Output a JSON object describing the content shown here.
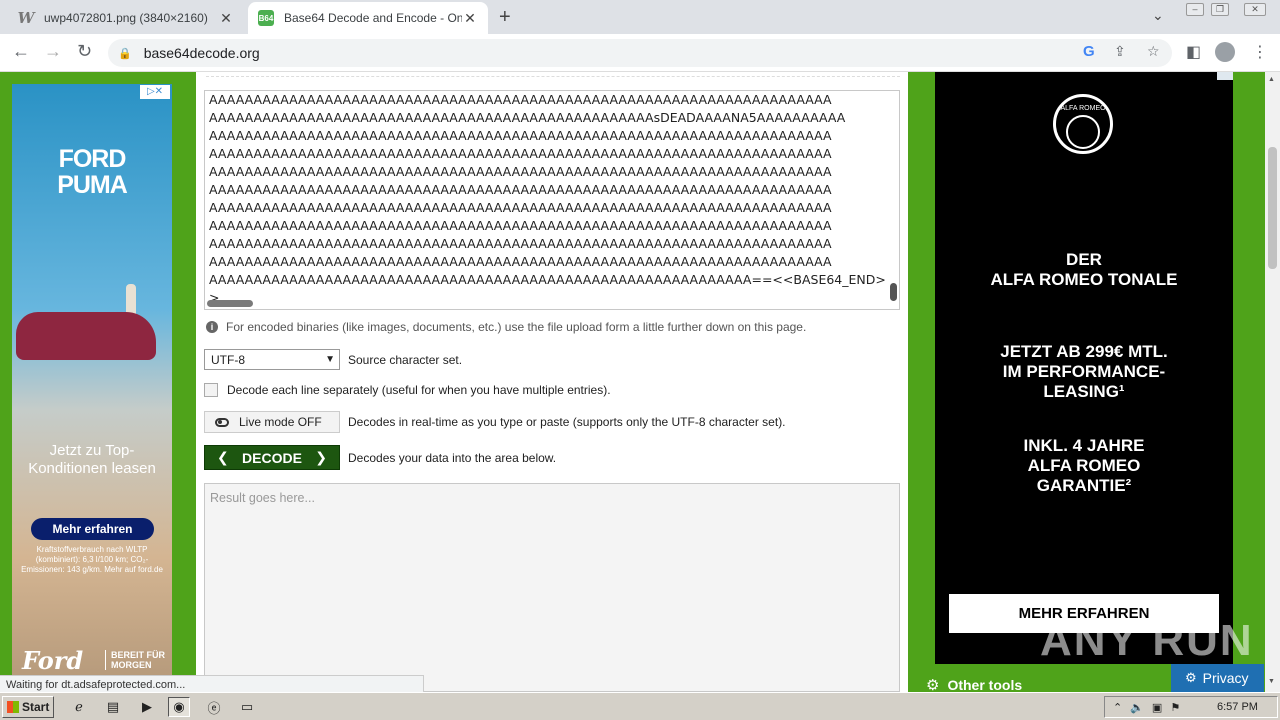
{
  "browser": {
    "tabs": [
      {
        "title": "uwp4072801.png (3840×2160)",
        "favicon": "W",
        "active": false
      },
      {
        "title": "Base64 Decode and Encode - Online",
        "favicon": "B64",
        "active": true
      }
    ],
    "url": "base64decode.org"
  },
  "ford_ad": {
    "headline": "FORD PUMA",
    "subline": "Jetzt zu Top-Konditionen leasen",
    "button": "Mehr erfahren",
    "fineprint": "Kraftstoffverbrauch nach WLTP (kombiniert): 6,3 l/100 km; CO₂-Emissionen: 143 g/km. Mehr auf ford.de",
    "logo": "Ford",
    "tagline": "BEREIT FÜR MORGEN"
  },
  "decoder": {
    "source_lines": [
      "AAAAAAAAAAAAAAAAAAAAAAAAAAAAAAAAAAAAAAAAAAAAAAAAAAAAAAAAAAAAAAAAAAAAAA",
      "AAAAAAAAAAAAAAAAAAAAAAAAAAAAAAAAAAAAAAAAAAAAAAAAAAsDEADAAAANA5AAAAAAAAAA",
      "AAAAAAAAAAAAAAAAAAAAAAAAAAAAAAAAAAAAAAAAAAAAAAAAAAAAAAAAAAAAAAAAAAAAAA",
      "AAAAAAAAAAAAAAAAAAAAAAAAAAAAAAAAAAAAAAAAAAAAAAAAAAAAAAAAAAAAAAAAAAAAAA",
      "AAAAAAAAAAAAAAAAAAAAAAAAAAAAAAAAAAAAAAAAAAAAAAAAAAAAAAAAAAAAAAAAAAAAAA",
      "AAAAAAAAAAAAAAAAAAAAAAAAAAAAAAAAAAAAAAAAAAAAAAAAAAAAAAAAAAAAAAAAAAAAAA",
      "AAAAAAAAAAAAAAAAAAAAAAAAAAAAAAAAAAAAAAAAAAAAAAAAAAAAAAAAAAAAAAAAAAAAAA",
      "AAAAAAAAAAAAAAAAAAAAAAAAAAAAAAAAAAAAAAAAAAAAAAAAAAAAAAAAAAAAAAAAAAAAAA",
      "AAAAAAAAAAAAAAAAAAAAAAAAAAAAAAAAAAAAAAAAAAAAAAAAAAAAAAAAAAAAAAAAAAAAAA",
      "AAAAAAAAAAAAAAAAAAAAAAAAAAAAAAAAAAAAAAAAAAAAAAAAAAAAAAAAAAAAAAAAAAAAAA",
      "AAAAAAAAAAAAAAAAAAAAAAAAAAAAAAAAAAAAAAAAAAAAAAAAAAAAAAAAAAAAA==<<BASE64_END>",
      ">"
    ],
    "binary_note": "For encoded binaries (like images, documents, etc.) use the file upload form a little further down on this page.",
    "charset_value": "UTF-8",
    "charset_label": "Source character set.",
    "each_line_label": "Decode each line separately (useful for when you have multiple entries).",
    "live_mode_button": "Live mode OFF",
    "live_mode_desc": "Decodes in real-time as you type or paste (supports only the UTF-8 character set).",
    "decode_button": "DECODE",
    "decode_desc": "Decodes your data into the area below.",
    "result_placeholder": "Result goes here..."
  },
  "alfa_ad": {
    "brand_badge": "ALFA ROMEO",
    "line1": "DER",
    "line2": "ALFA ROMEO TONALE",
    "line3": "JETZT AB 299€ MTL.",
    "line4": "IM PERFORMANCE-",
    "line5": "LEASING¹",
    "line6": "INKL. 4 JAHRE",
    "line7": "ALFA ROMEO",
    "line8": "GARANTIE²",
    "button": "MEHR ERFAHREN"
  },
  "other_tools": "Other tools",
  "privacy": "Privacy",
  "watermark": "ANY RUN",
  "status": "Waiting for dt.adsafeprotected.com...",
  "taskbar": {
    "start": "Start",
    "clock": "6:57 PM"
  }
}
